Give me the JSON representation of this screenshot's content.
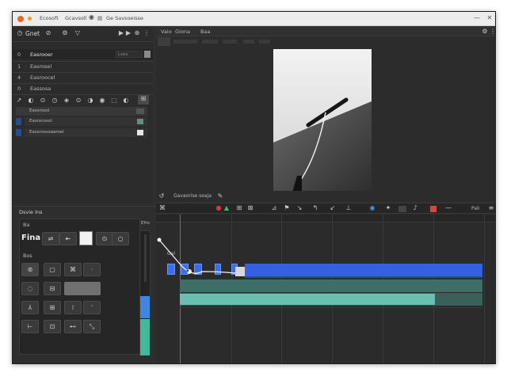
{
  "window": {
    "title_left": "Ecosoft",
    "title_mid": "Gcavsoll",
    "title_right": "Ge Savsoeisse",
    "ctrl_min": "—",
    "ctrl_close": "✕"
  },
  "left_top": {
    "header_label": "Gnet",
    "header_icons": [
      "▶",
      "▶",
      "⊕"
    ],
    "properties": [
      {
        "num": "0",
        "label": "Easrooer",
        "value": "Lsex"
      },
      {
        "num": "1",
        "label": "Easrosel"
      },
      {
        "num": "4",
        "label": "Easroocel"
      },
      {
        "num": "0",
        "label": "Eassosa"
      }
    ],
    "tools": [
      "↗",
      "◐",
      "⊙",
      "◷",
      "◈",
      "⊙",
      "◑",
      "◉",
      "⬚",
      "◐",
      "⊞"
    ],
    "layers": [
      {
        "label": "Eassrossl"
      },
      {
        "label": "Easrocssol"
      },
      {
        "label": "Eassrosssaaroel"
      }
    ]
  },
  "left_bottom": {
    "title": "Dsvie Ins",
    "tab": "Ba",
    "font_name": "Fina",
    "section": "Bos",
    "meter_label": "Efro"
  },
  "viewer": {
    "menu": [
      "Vaio",
      "Giona",
      "Baa"
    ],
    "status": "Gavaorise seaja"
  },
  "timeline": {
    "ruler_label": "Gal",
    "right_label": "Pali"
  },
  "colors": {
    "blue_clip": "#3b6ee8",
    "teal_track": "#3e6e66",
    "teal_light": "#6bbfb0",
    "red_button": "#d44a3a",
    "green_meter": "#44b89a",
    "blue_meter": "#3f86e0"
  }
}
